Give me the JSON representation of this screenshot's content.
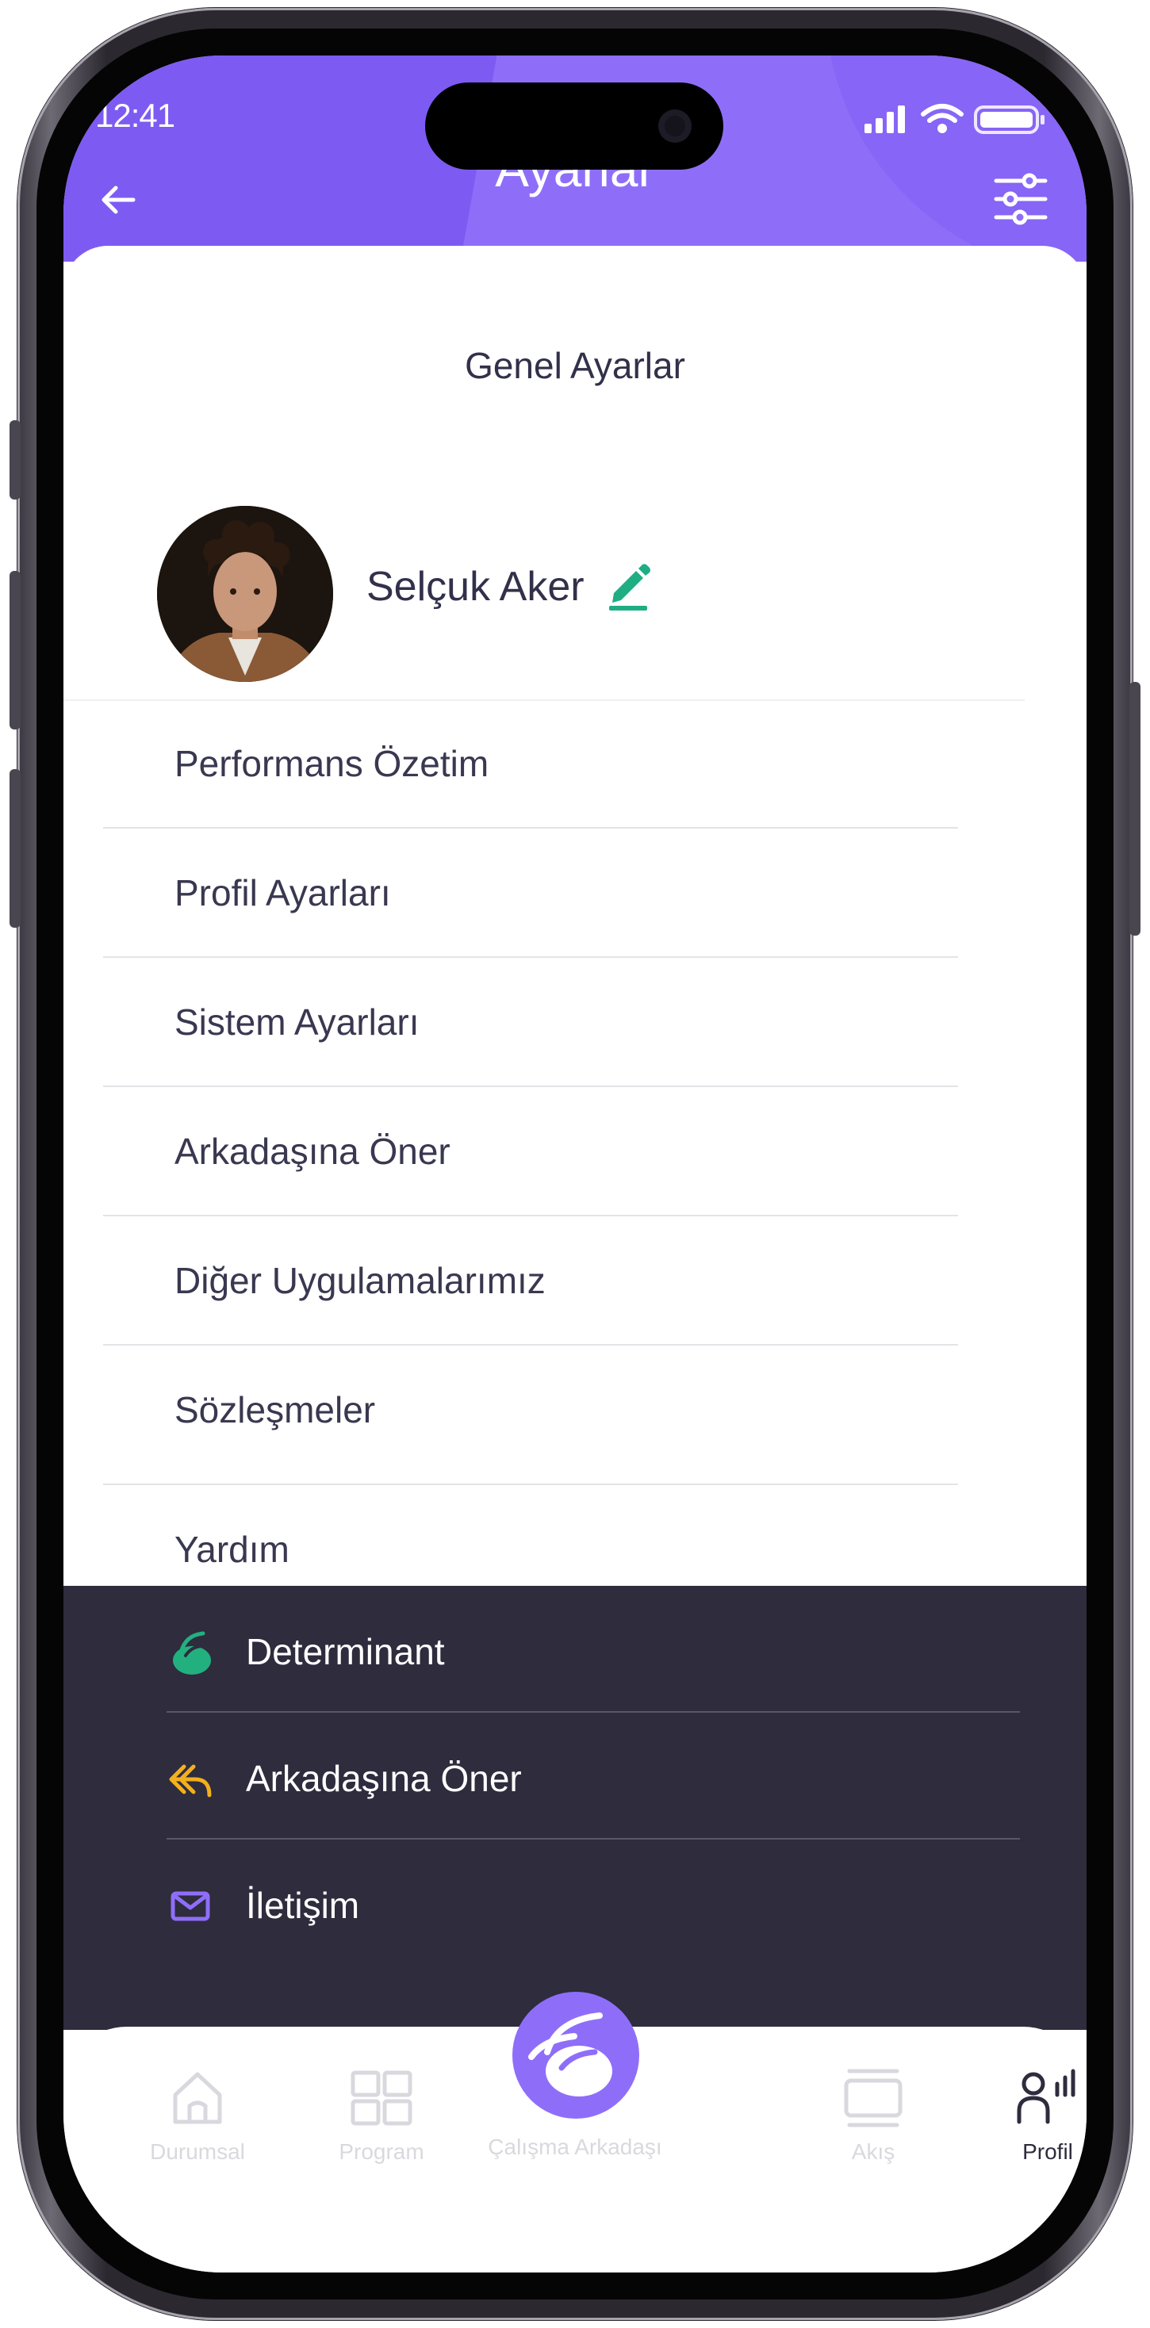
{
  "status_bar": {
    "time": "12:41"
  },
  "header": {
    "title": "Ayarlar"
  },
  "general": {
    "section_title": "Genel Ayarlar"
  },
  "profile": {
    "name": "Selçuk Aker"
  },
  "menu": {
    "items": [
      {
        "label": "Performans Özetim"
      },
      {
        "label": "Profil Ayarları"
      },
      {
        "label": "Sistem Ayarları"
      },
      {
        "label": "Arkadaşına Öner"
      },
      {
        "label": "Diğer Uygulamalarımız"
      },
      {
        "label": "Sözleşmeler"
      },
      {
        "label": "Yardım"
      }
    ]
  },
  "dark_menu": {
    "items": [
      {
        "label": "Determinant",
        "icon": "determinant-logo-icon"
      },
      {
        "label": "Arkadaşına Öner",
        "icon": "reply-arrow-icon"
      },
      {
        "label": "İletişim",
        "icon": "mail-icon"
      }
    ]
  },
  "tabbar": {
    "tabs": [
      {
        "label": "Durumsal",
        "icon": "home-icon"
      },
      {
        "label": "Program",
        "icon": "grid-icon"
      },
      {
        "label": "Çalışma Arkadaşı",
        "icon": "app-logo-icon"
      },
      {
        "label": "Akış",
        "icon": "stack-icon"
      },
      {
        "label": "Profil",
        "icon": "profile-icon"
      }
    ],
    "active": "Profil"
  },
  "colors": {
    "brand_purple": "#8e6ef9",
    "dark_panel": "#2e2c3d",
    "edit_green": "#1fae84",
    "determinant_green": "#22b07f",
    "reply_yellow": "#f2b01e",
    "mail_purple": "#8e6ef9"
  }
}
